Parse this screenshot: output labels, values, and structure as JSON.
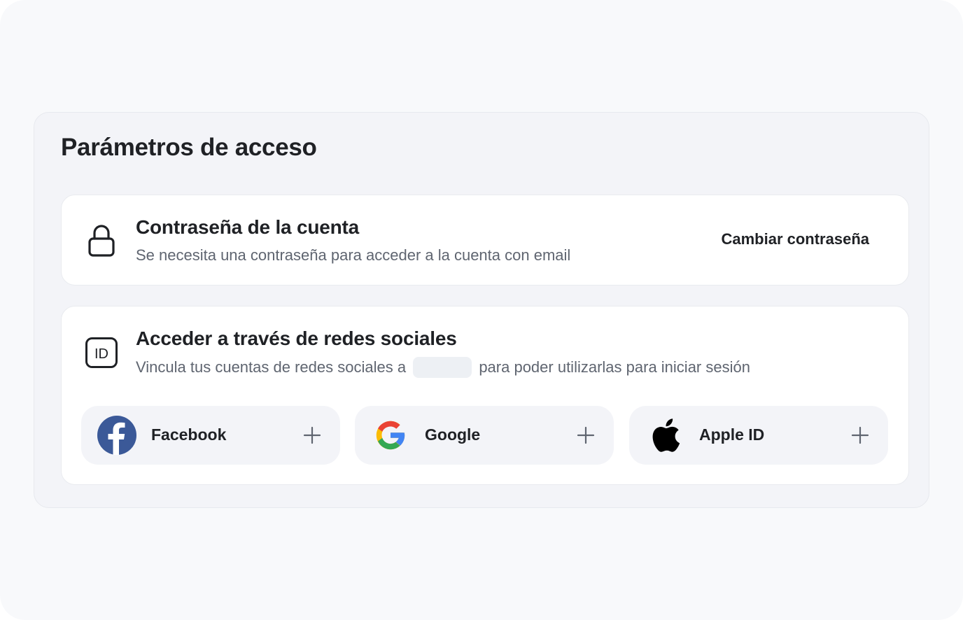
{
  "panel": {
    "title": "Parámetros de acceso"
  },
  "password": {
    "icon": "lock-icon",
    "title": "Contraseña de la cuenta",
    "description": "Se necesita una contraseña para acceder a la cuenta con email",
    "action_label": "Cambiar contraseña"
  },
  "social": {
    "icon": "id-card-icon",
    "title": "Acceder a través de redes sociales",
    "description_before": "Vincula tus cuentas de redes sociales a",
    "description_after": "para poder utilizarlas para iniciar sesión",
    "providers": [
      {
        "name": "Facebook",
        "icon": "facebook-icon",
        "action_icon": "plus-icon"
      },
      {
        "name": "Google",
        "icon": "google-icon",
        "action_icon": "plus-icon"
      },
      {
        "name": "Apple ID",
        "icon": "apple-icon",
        "action_icon": "plus-icon"
      }
    ]
  },
  "colors": {
    "facebook": "#3b5998",
    "google_blue": "#4285f4",
    "google_red": "#ea4335",
    "google_yellow": "#fbbc05",
    "google_green": "#34a853",
    "text_primary": "#1f2125",
    "text_secondary": "#5f6570"
  }
}
